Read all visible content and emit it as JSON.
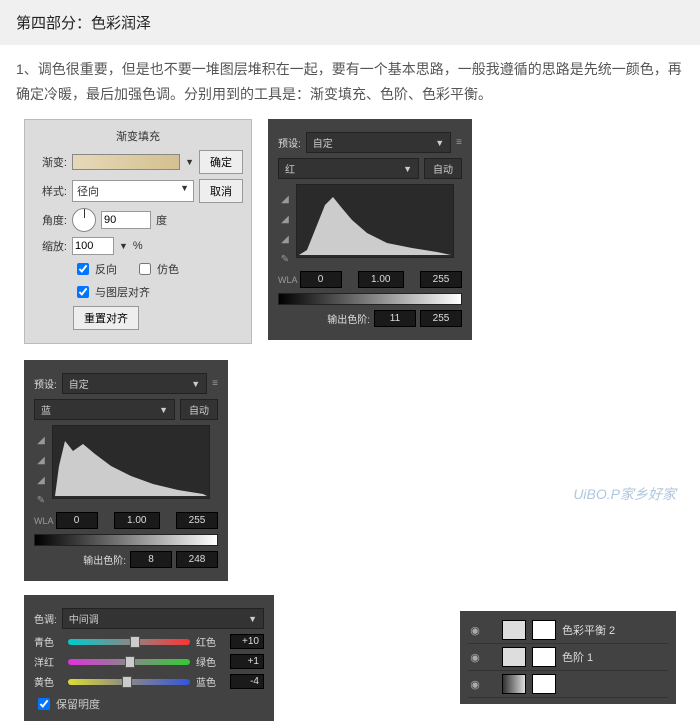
{
  "header": {
    "title": "第四部分：色彩润泽"
  },
  "intro": {
    "text": "1、调色很重要，但是也不要一堆图层堆积在一起，要有一个基本思路，一般我遵循的思路是先统一颜色，再确定冷暖，最后加强色调。分别用到的工具是：渐变填充、色阶、色彩平衡。"
  },
  "gradient": {
    "title": "渐变填充",
    "grad_label": "渐变:",
    "ok": "确定",
    "cancel": "取消",
    "style_label": "样式:",
    "style_value": "径向",
    "angle_label": "角度:",
    "angle_value": "90",
    "angle_unit": "度",
    "scale_label": "缩放:",
    "scale_value": "100",
    "scale_unit": "%",
    "reverse": "反向",
    "dither": "仿色",
    "align": "与图层对齐",
    "reset": "重置对齐"
  },
  "levels1": {
    "preset": "预设:",
    "preset_value": "自定",
    "channel": "红",
    "auto": "自动",
    "in_low": "0",
    "in_mid": "1.00",
    "in_high": "255",
    "out_label": "输出色阶:",
    "out_low": "11",
    "out_high": "255"
  },
  "levels2": {
    "preset": "预设:",
    "preset_value": "自定",
    "channel": "蓝",
    "auto": "自动",
    "in_low": "0",
    "in_mid": "1.00",
    "in_high": "255",
    "out_label": "输出色阶:",
    "out_low": "8",
    "out_high": "248"
  },
  "balance": {
    "tone_label": "色调:",
    "tone_value": "中间调",
    "cyan": "青色",
    "red": "红色",
    "red_val": "+10",
    "magenta": "洋红",
    "green": "绿色",
    "green_val": "+1",
    "yellow": "黄色",
    "blue": "蓝色",
    "blue_val": "-4",
    "preserve": "保留明度"
  },
  "layers": {
    "items": [
      {
        "name": "色彩平衡 2"
      },
      {
        "name": "色阶 1"
      },
      {
        "name": ""
      }
    ]
  },
  "watermark": "UiBO.P家乡好家"
}
